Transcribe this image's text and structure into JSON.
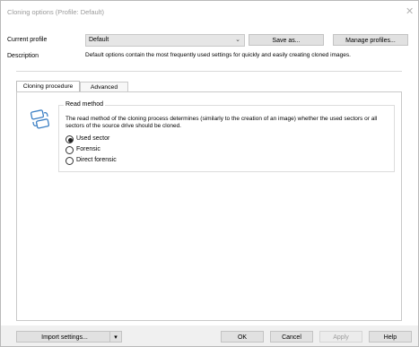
{
  "window": {
    "title": "Cloning options (Profile: Default)",
    "close_glyph": "✕"
  },
  "profile": {
    "label": "Current profile",
    "value": "Default",
    "save_as": "Save as...",
    "manage": "Manage profiles..."
  },
  "description": {
    "label": "Description",
    "text": "Default options contain the most frequently used settings for quickly and easily creating cloned images."
  },
  "tabs": [
    {
      "label": "Cloning procedure",
      "active": true
    },
    {
      "label": "Advanced",
      "active": false
    }
  ],
  "read_method": {
    "title": "Read method",
    "description": "The read method of the cloning process determines (similarly to the creation of an image) whether the used sectors or all sectors of the source drive should be cloned.",
    "options": [
      {
        "label": "Used sector",
        "selected": true
      },
      {
        "label": "Forensic",
        "selected": false
      },
      {
        "label": "Direct forensic",
        "selected": false
      }
    ],
    "icon": "clone-drives-icon"
  },
  "footer": {
    "import": "Import settings...",
    "ok": "OK",
    "cancel": "Cancel",
    "apply": "Apply",
    "help": "Help"
  },
  "colors": {
    "window_bg": "#f0f0f0",
    "icon_blue": "#3b7fc4",
    "disabled_text": "#9d9d9d"
  }
}
